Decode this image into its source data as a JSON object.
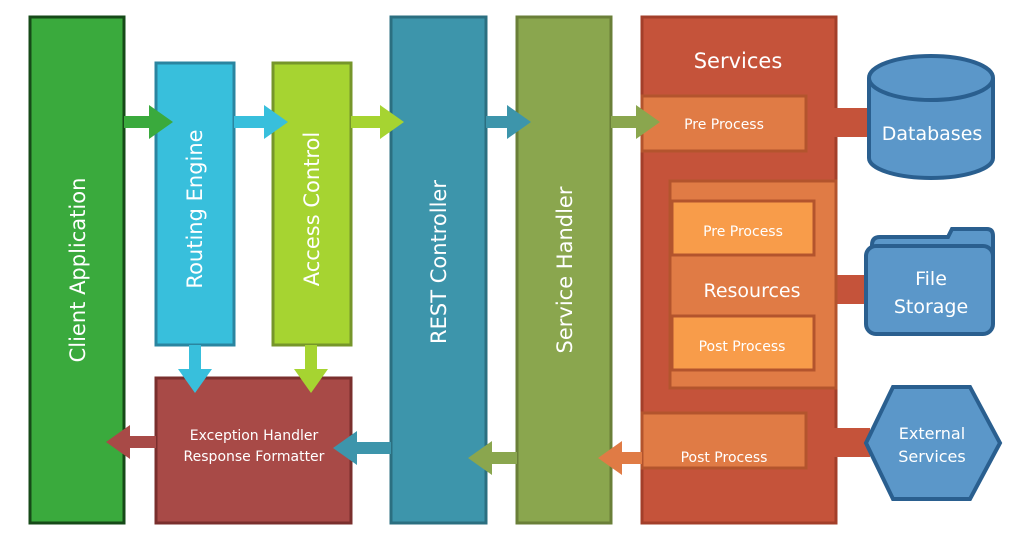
{
  "components": {
    "client_application": "Client Application",
    "routing_engine": "Routing Engine",
    "access_control": "Access Control",
    "exception_handler": [
      "Exception Handler",
      "Response Formatter"
    ],
    "rest_controller": "REST Controller",
    "service_handler": "Service Handler",
    "services": {
      "title": "Services",
      "pre_process": "Pre Process",
      "post_process": "Post Process",
      "resources": {
        "title": "Resources",
        "pre_process": "Pre Process",
        "post_process": "Post Process"
      }
    },
    "databases": "Databases",
    "file_storage": [
      "File",
      "Storage"
    ],
    "external_services": [
      "External",
      "Services"
    ]
  },
  "colors": {
    "client_application": "#3aaa3d",
    "routing_engine": "#38bfdc",
    "access_control": "#a6d431",
    "exception_handler": "#a84a47",
    "rest_controller": "#3d95ab",
    "service_handler": "#8aa64e",
    "services": "#c5533a",
    "process": "#e07b45",
    "resource_process": "#f89c4a",
    "storage": "#5b97c9"
  }
}
